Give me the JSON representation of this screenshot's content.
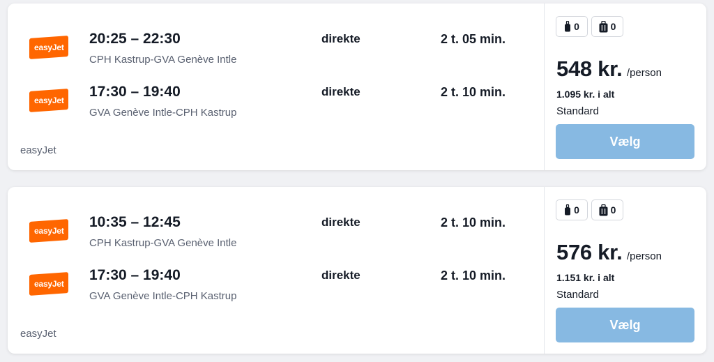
{
  "colors": {
    "brand_orange": "#ff6600",
    "select_button": "#87b9e2",
    "card_bg": "#ffffff",
    "page_bg": "#f0f1f4"
  },
  "results": [
    {
      "legs": [
        {
          "logo_text": "easyJet",
          "times": "20:25 – 22:30",
          "route": "CPH Kastrup-GVA Genève Intle",
          "stops": "direkte",
          "duration": "2 t. 05 min."
        },
        {
          "logo_text": "easyJet",
          "times": "17:30 – 19:40",
          "route": "GVA Genève Intle-CPH Kastrup",
          "stops": "direkte",
          "duration": "2 t. 10 min."
        }
      ],
      "airline": "easyJet",
      "bags": {
        "personal_item": "0",
        "carry_on": "0"
      },
      "price": "548 kr.",
      "per_person": "/person",
      "total": "1.095 kr. i alt",
      "fare_class": "Standard",
      "select_label": "Vælg"
    },
    {
      "legs": [
        {
          "logo_text": "easyJet",
          "times": "10:35 – 12:45",
          "route": "CPH Kastrup-GVA Genève Intle",
          "stops": "direkte",
          "duration": "2 t. 10 min."
        },
        {
          "logo_text": "easyJet",
          "times": "17:30 – 19:40",
          "route": "GVA Genève Intle-CPH Kastrup",
          "stops": "direkte",
          "duration": "2 t. 10 min."
        }
      ],
      "airline": "easyJet",
      "bags": {
        "personal_item": "0",
        "carry_on": "0"
      },
      "price": "576 kr.",
      "per_person": "/person",
      "total": "1.151 kr. i alt",
      "fare_class": "Standard",
      "select_label": "Vælg"
    }
  ]
}
